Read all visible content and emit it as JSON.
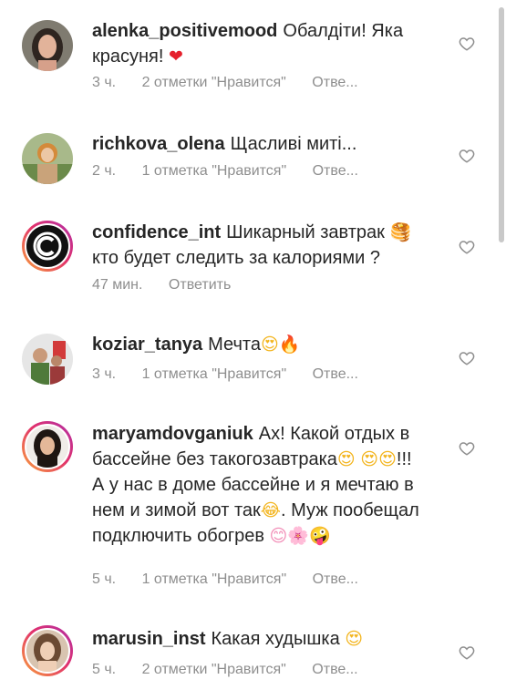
{
  "comments": [
    {
      "username": "alenka_positivemood",
      "text": "Обалдіти! Яка красуня!",
      "emoji": "❤",
      "time": "3 ч.",
      "likes": "2 отметки \"Нравится\"",
      "reply": "Отве..."
    },
    {
      "username": "richkova_olena",
      "text": "Щасливі миті...",
      "time": "2 ч.",
      "likes": "1 отметка \"Нравится\"",
      "reply": "Отве..."
    },
    {
      "username": "confidence_int",
      "text": "Шикарный завтрак",
      "emoji": "🥞",
      "text2": "кто будет следить за калориями ?",
      "time": "47 мин.",
      "reply": "Ответить"
    },
    {
      "username": "koziar_tanya",
      "text": "Мечта",
      "emoji": "😍",
      "emoji2": "🔥",
      "time": "3 ч.",
      "likes": "1 отметка \"Нравится\"",
      "reply": "Отве..."
    },
    {
      "username": "maryamdovganiuk",
      "text": "Ах! Какой отдых в бассейне без такогозавтрака",
      "emoji": "😍",
      "emoji_pair": "😍😍",
      "text2": "!!! А у нас в доме бассейне и я мечтаю в нем и зимой вот так",
      "emoji2": "😂",
      "text3": ". Муж пообещал подключить обогрев",
      "emoji_end": "😊🌸🤪",
      "time": "5 ч.",
      "likes": "1 отметка \"Нравится\"",
      "reply": "Отве..."
    },
    {
      "username": "marusin_inst",
      "text": "Какая худышка",
      "emoji": "😍",
      "time": "5 ч.",
      "likes": "2 отметки \"Нравится\"",
      "reply": "Отве..."
    }
  ],
  "colors": {
    "text": "#262626",
    "meta": "#8e8e8e",
    "story_ring_start": "#f9a33b",
    "story_ring_end": "#b02fa8",
    "heart_outline": "#8e8e8e"
  }
}
